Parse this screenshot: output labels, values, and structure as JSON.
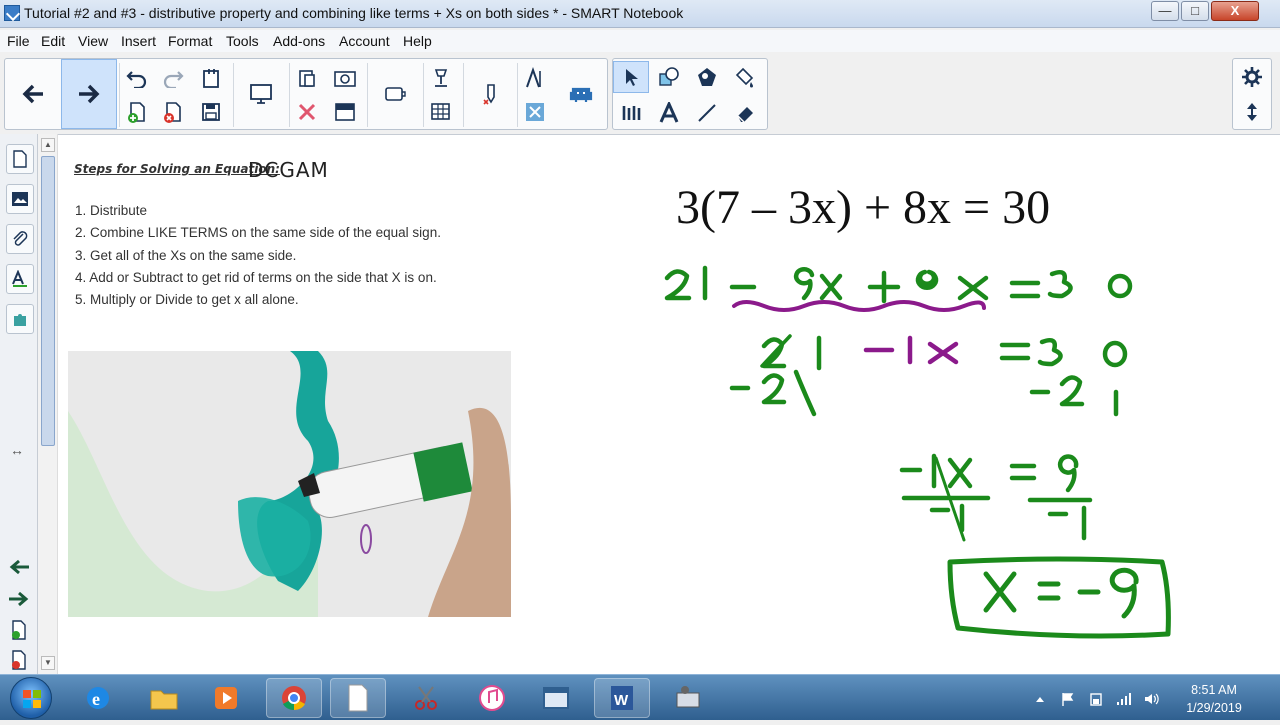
{
  "window": {
    "title": "Tutorial #2 and #3 - distributive property and combining like terms + Xs on both sides * - SMART Notebook",
    "min_label": "—",
    "max_label": "□",
    "close_label": "X"
  },
  "menu": [
    "File",
    "Edit",
    "View",
    "Insert",
    "Format",
    "Tools",
    "Add-ons",
    "Account",
    "Help"
  ],
  "page": {
    "steps_title": "Steps for Solving an Equation:",
    "steps_acronym": "DCGAM",
    "steps": [
      "1. Distribute",
      "2. Combine LIKE TERMS on the same side of the equal sign.",
      "3. Get all of the Xs on the same side.",
      "4. Add or Subtract to get rid of terms on the side that X is on.",
      "5. Multiply or Divide to get x all alone."
    ],
    "equation": "3(7 – 3x) + 8x = 30",
    "handwriting": {
      "line1": "21 - 9x + 8x = 30",
      "line2": "21 -1x = 30",
      "line3": "-21    -21",
      "line4": "-1x = 9",
      "line5": "-1    -1",
      "answer": "x = -9"
    }
  },
  "taskbar": {
    "time": "8:51 AM",
    "date": "1/29/2019"
  },
  "colors": {
    "ink_green": "#1b8a1b",
    "ink_purple": "#8b1a8b"
  }
}
